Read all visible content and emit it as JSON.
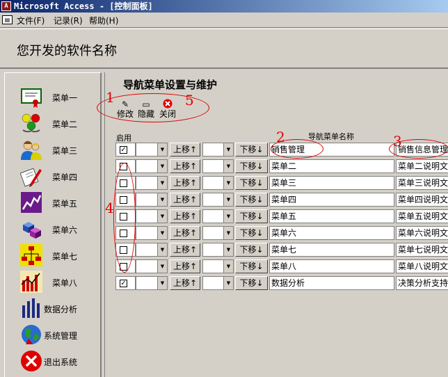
{
  "window": {
    "title": "Microsoft Access - [控制面板]"
  },
  "menubar": {
    "items": [
      "文件(F)",
      "记录(R)",
      "帮助(H)"
    ]
  },
  "header": {
    "app_name": "您开发的软件名称"
  },
  "sidebar": {
    "items": [
      {
        "label": "菜单一",
        "icon": "certificate-icon"
      },
      {
        "label": "菜单二",
        "icon": "molecules-icon"
      },
      {
        "label": "菜单三",
        "icon": "people-icon"
      },
      {
        "label": "菜单四",
        "icon": "notepad-pen-icon"
      },
      {
        "label": "菜单五",
        "icon": "line-chart-icon"
      },
      {
        "label": "菜单六",
        "icon": "cubes-icon"
      },
      {
        "label": "菜单七",
        "icon": "org-chart-icon"
      },
      {
        "label": "菜单八",
        "icon": "bar-chart-icon"
      },
      {
        "label": "数据分析",
        "icon": "bars-icon"
      },
      {
        "label": "系统管理",
        "icon": "globe-icon"
      },
      {
        "label": "退出系统",
        "icon": "exit-icon"
      }
    ]
  },
  "panel": {
    "title": "导航菜单设置与维护",
    "toolbar": {
      "edit": "修改",
      "hide": "隐藏",
      "close": "关闭"
    },
    "columns": {
      "enabled": "启用",
      "name": "导航菜单名称"
    },
    "move_up": "上移↑",
    "move_down": "下移↓",
    "rows": [
      {
        "enabled": true,
        "name": "销售管理",
        "desc": "销售信息管理"
      },
      {
        "enabled": false,
        "name": "菜单二",
        "desc": "菜单二说明文字"
      },
      {
        "enabled": false,
        "name": "菜单三",
        "desc": "菜单三说明文字"
      },
      {
        "enabled": false,
        "name": "菜单四",
        "desc": "菜单四说明文字"
      },
      {
        "enabled": false,
        "name": "菜单五",
        "desc": "菜单五说明文字"
      },
      {
        "enabled": false,
        "name": "菜单六",
        "desc": "菜单六说明文字"
      },
      {
        "enabled": false,
        "name": "菜单七",
        "desc": "菜单七说明文字"
      },
      {
        "enabled": false,
        "name": "菜单八",
        "desc": "菜单八说明文字"
      },
      {
        "enabled": true,
        "name": "数据分析",
        "desc": "决策分析支持"
      }
    ]
  },
  "annotations": [
    "1",
    "2",
    "3",
    "4",
    "5"
  ],
  "colors": {
    "titlebar": "#0a246a",
    "annotation": "#e00000",
    "face": "#d4d0c8"
  }
}
